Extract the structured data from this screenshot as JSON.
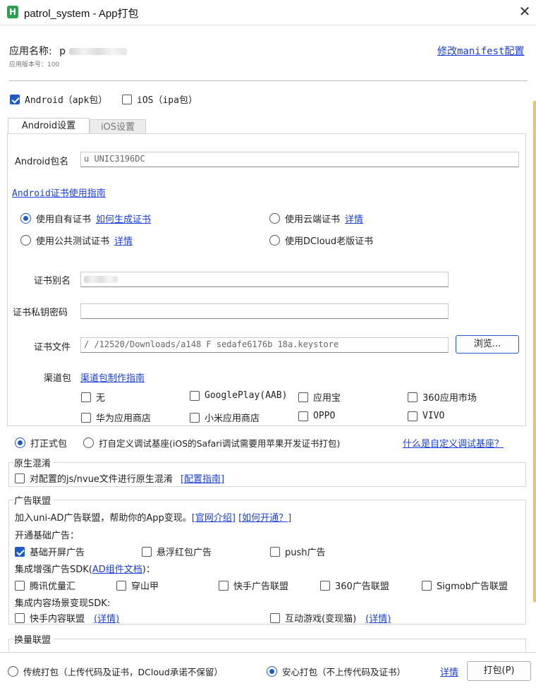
{
  "window": {
    "logo": "H",
    "title": "patrol_system - App打包",
    "close": "✕"
  },
  "header": {
    "app_name_label": "应用名称:",
    "app_name_value": "p",
    "app_version": "应用版本号：100",
    "manifest_link": "修改manifest配置"
  },
  "platforms": [
    {
      "label": "Android（apk包）",
      "checked": true
    },
    {
      "label": "iOS（ipa包）",
      "checked": false
    }
  ],
  "tabs": [
    {
      "label": "Android设置",
      "active": true
    },
    {
      "label": "iOS设置",
      "active": false
    }
  ],
  "android": {
    "package_label": "Android包名",
    "package_value": "u   UNIC3196DC",
    "cert_guide_link": "Android证书使用指南",
    "cert_options": [
      {
        "label": "使用自有证书",
        "link": "如何生成证书",
        "checked": true
      },
      {
        "label": "使用云端证书",
        "link": "详情",
        "checked": false
      },
      {
        "label": "使用公共测试证书",
        "link": "详情",
        "checked": false
      },
      {
        "label": "使用DCloud老版证书",
        "link": "",
        "checked": false
      }
    ],
    "alias_label": "证书别名",
    "alias_value": "",
    "password_label": "证书私钥密码",
    "password_value": "",
    "file_label": "证书文件",
    "file_value": "/      /12520/Downloads/a148  F     sedafe6176b      18a.keystore",
    "browse_button": "浏览...",
    "channel_label": "渠道包",
    "channel_link": "渠道包制作指南",
    "channels": [
      {
        "label": "无",
        "checked": false
      },
      {
        "label": "GooglePlay(AAB)",
        "checked": false
      },
      {
        "label": "应用宝",
        "checked": false
      },
      {
        "label": "360应用市场",
        "checked": false
      },
      {
        "label": "华为应用商店",
        "checked": false
      },
      {
        "label": "小米应用商店",
        "checked": false
      },
      {
        "label": "OPPO",
        "checked": false
      },
      {
        "label": "VIVO",
        "checked": false
      }
    ]
  },
  "build_type": {
    "release_label": "打正式包",
    "release_checked": true,
    "custom_label": "打自定义调试基座(iOS的Safari调试需要用苹果开发证书打包)",
    "custom_checked": false,
    "what_link": "什么是自定义调试基座？"
  },
  "obfuscation": {
    "title": "原生混淆",
    "option_label": "对配置的js/nvue文件进行原生混淆",
    "option_checked": false,
    "guide_link": "[配置指南]"
  },
  "ads": {
    "title": "广告联盟",
    "intro": "加入uni-AD广告联盟，帮助你的App变现。",
    "intro_link1": "[官网介绍]",
    "intro_link2": "[如何开通？]",
    "basic_heading": "开通基础广告：",
    "basic": [
      {
        "label": "基础开屏广告",
        "checked": true
      },
      {
        "label": "悬浮红包广告",
        "checked": false
      },
      {
        "label": "push广告",
        "checked": false
      }
    ],
    "sdk_heading_prefix": "集成增强广告SDK(",
    "sdk_heading_link": "AD组件文档",
    "sdk_heading_suffix": ")：",
    "sdk": [
      {
        "label": "腾讯优量汇",
        "checked": false
      },
      {
        "label": "穿山甲",
        "checked": false
      },
      {
        "label": "快手广告联盟",
        "checked": false
      },
      {
        "label": "360广告联盟",
        "checked": false
      },
      {
        "label": "Sigmob广告联盟",
        "checked": false
      }
    ],
    "content_heading": "集成内容场景变现SDK:",
    "content": [
      {
        "label": "快手内容联盟",
        "link": "(详情)",
        "checked": false
      },
      {
        "label": "互动游戏(变现猫)",
        "link": "(详情)",
        "checked": false
      }
    ]
  },
  "exchange": {
    "title": "换量联盟"
  },
  "footer": {
    "traditional_label": "传统打包（上传代码及证书，DCloud承诺不保留）",
    "traditional_checked": false,
    "safe_label": "安心打包（不上传代码及证书）",
    "safe_checked": true,
    "details_link": "详情",
    "pack_button": "打包(P)"
  }
}
